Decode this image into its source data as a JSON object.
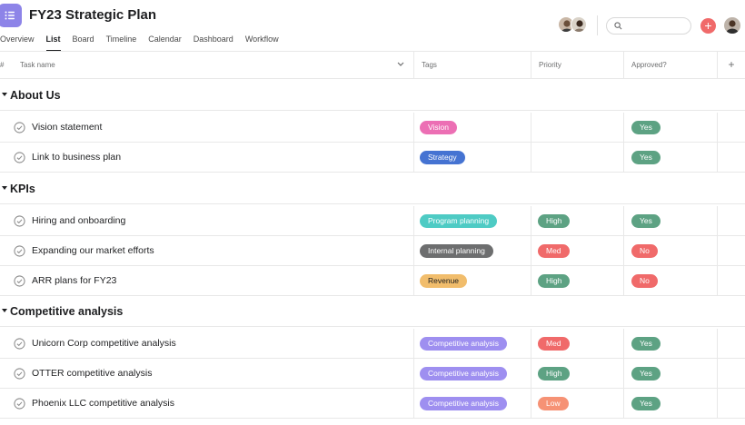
{
  "project": {
    "title": "FY23 Strategic Plan",
    "icon": "list-icon",
    "icon_color": "#8d84e8"
  },
  "tabs": [
    {
      "label": "Overview",
      "active": false
    },
    {
      "label": "List",
      "active": true
    },
    {
      "label": "Board",
      "active": false
    },
    {
      "label": "Timeline",
      "active": false
    },
    {
      "label": "Calendar",
      "active": false
    },
    {
      "label": "Dashboard",
      "active": false
    },
    {
      "label": "Workflow",
      "active": false
    }
  ],
  "toolbar": {
    "search_placeholder": "",
    "add_icon": "plus-icon",
    "accent": "#f06a6a"
  },
  "columns": {
    "hash": "#",
    "name": "Task name",
    "tags": "Tags",
    "priority": "Priority",
    "approved": "Approved?",
    "add": "+"
  },
  "colors": {
    "pink": "#ec6fb4",
    "blue": "#4573d2",
    "teal": "#4ecbc4",
    "gray": "#6d6e6f",
    "yellow": "#f1bd6c",
    "purple": "#9e8ff0",
    "green": "#5da283",
    "red": "#f06a6a",
    "orange": "#f69275"
  },
  "sections": [
    {
      "title": "About Us",
      "tasks": [
        {
          "name": "Vision statement",
          "tag": "Vision",
          "tag_color": "pink",
          "priority": "",
          "priority_color": "",
          "approved": "Yes",
          "approved_color": "green"
        },
        {
          "name": "Link to business plan",
          "tag": "Strategy",
          "tag_color": "blue",
          "priority": "",
          "priority_color": "",
          "approved": "Yes",
          "approved_color": "green"
        }
      ]
    },
    {
      "title": "KPIs",
      "tasks": [
        {
          "name": "Hiring and onboarding",
          "tag": "Program planning",
          "tag_color": "teal",
          "priority": "High",
          "priority_color": "green",
          "approved": "Yes",
          "approved_color": "green"
        },
        {
          "name": "Expanding our market efforts",
          "tag": "Internal planning",
          "tag_color": "gray",
          "priority": "Med",
          "priority_color": "red",
          "approved": "No",
          "approved_color": "red"
        },
        {
          "name": "ARR plans for FY23",
          "tag": "Revenue",
          "tag_color": "yellow",
          "priority": "High",
          "priority_color": "green",
          "approved": "No",
          "approved_color": "red"
        }
      ]
    },
    {
      "title": "Competitive analysis",
      "tasks": [
        {
          "name": "Unicorn Corp competitive analysis",
          "tag": "Competitive analysis",
          "tag_color": "purple",
          "priority": "Med",
          "priority_color": "red",
          "approved": "Yes",
          "approved_color": "green"
        },
        {
          "name": "OTTER competitive analysis",
          "tag": "Competitive analysis",
          "tag_color": "purple",
          "priority": "High",
          "priority_color": "green",
          "approved": "Yes",
          "approved_color": "green"
        },
        {
          "name": "Phoenix LLC competitive analysis",
          "tag": "Competitive analysis",
          "tag_color": "purple",
          "priority": "Low",
          "priority_color": "orange",
          "approved": "Yes",
          "approved_color": "green"
        }
      ]
    }
  ]
}
